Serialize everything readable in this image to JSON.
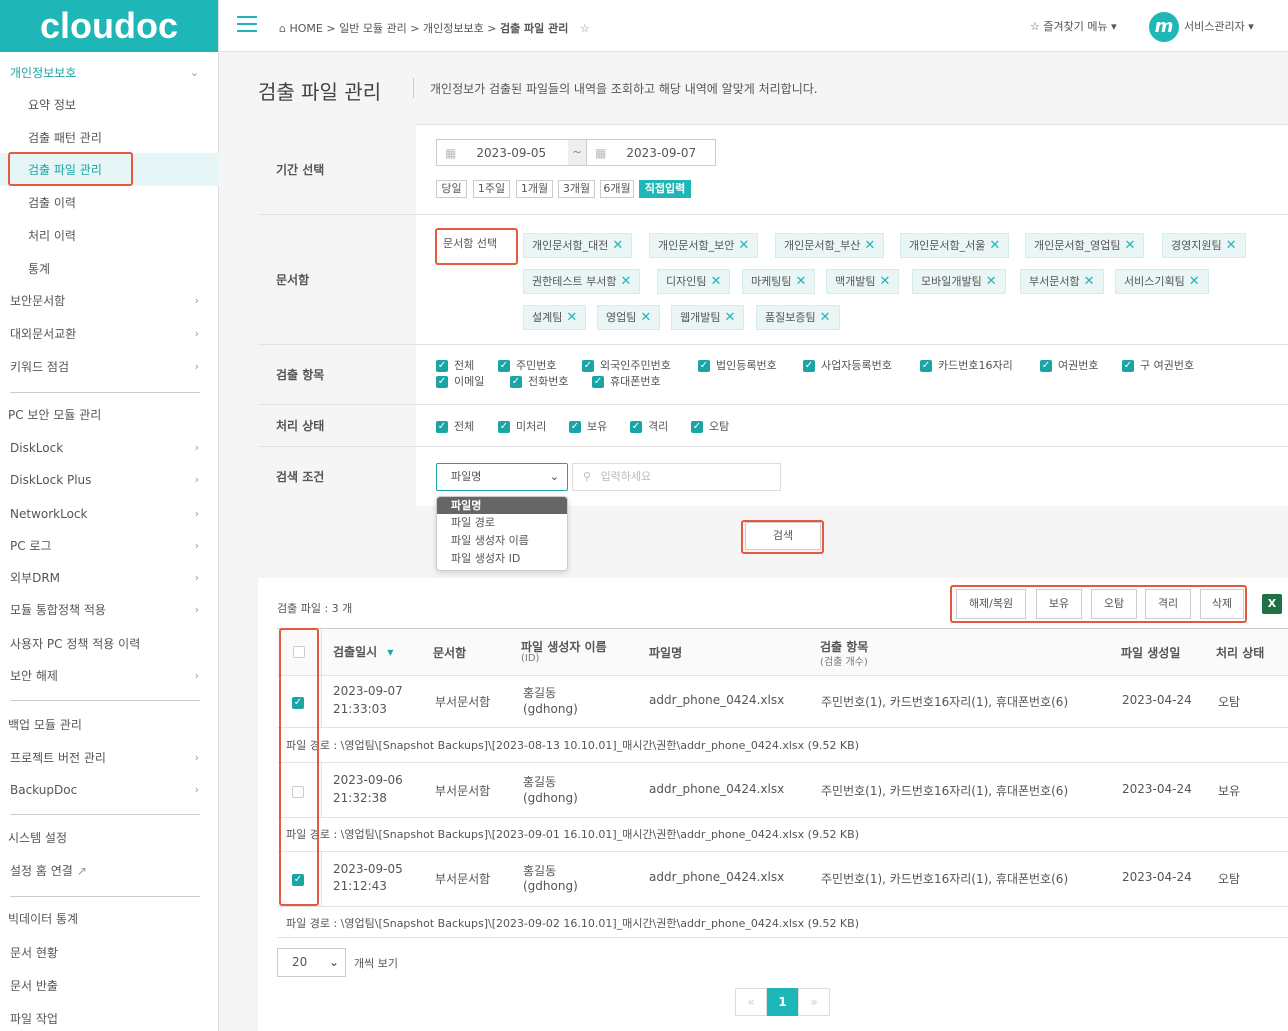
{
  "logo": "cloudoc",
  "breadcrumb": {
    "home": "HOME",
    "sep": ">",
    "b1": "일반 모듈 관리",
    "b2": "개인정보보호",
    "b3": "검출 파일 관리"
  },
  "header": {
    "favorites": "즐겨찾기 메뉴",
    "user": "서비스관리자"
  },
  "sidebar": {
    "groups": [
      {
        "label": "개인정보보호",
        "expanded": true
      },
      {
        "label": "보안문서함"
      },
      {
        "label": "대외문서교환"
      },
      {
        "label": "키워드 점검"
      }
    ],
    "privacy_items": [
      "요약 정보",
      "검출 패턴 관리",
      "검출 파일 관리",
      "검출 이력",
      "처리 이력",
      "통계"
    ],
    "section_pc": "PC 보안 모듈 관리",
    "pc_items": [
      "DiskLock",
      "DiskLock Plus",
      "NetworkLock",
      "PC 로그",
      "외부DRM",
      "모듈 통합정책 적용",
      "사용자 PC 정책 적용 이력",
      "보안 해제"
    ],
    "section_backup": "백업 모듈 관리",
    "backup_items": [
      "프로젝트 버전 관리",
      "BackupDoc"
    ],
    "section_system": "시스템 설정",
    "system_items": [
      "설정 홈 연결"
    ],
    "section_bigdata": "빅데이터 통계",
    "bigdata_items": [
      "문서 현황",
      "문서 반출",
      "파일 작업"
    ]
  },
  "page": {
    "title": "검출 파일 관리",
    "desc": "개인정보가 검출된 파일들의 내역을 조회하고 해당 내역에 알맞게 처리합니다."
  },
  "filters": {
    "period_label": "기간 선택",
    "date_from": "2023-09-05",
    "date_to": "2023-09-07",
    "date_sep": "~",
    "periods": [
      "당일",
      "1주일",
      "1개월",
      "3개월",
      "6개월",
      "직접입력"
    ],
    "box_label": "문서함",
    "box_select_btn": "문서함 선택",
    "boxes": [
      "개인문서함_대전",
      "개인문서함_보안",
      "개인문서함_부산",
      "개인문서함_서울",
      "개인문서함_영업팀",
      "경영지원팀",
      "권한테스트 부서함",
      "디자인팀",
      "마케팅팀",
      "맥개발팀",
      "모바일개발팀",
      "부서문서함",
      "서비스기획팀",
      "설계팀",
      "영업팀",
      "웹개발팀",
      "품질보증팀"
    ],
    "items_label": "검출 항목",
    "items": [
      "전체",
      "주민번호",
      "외국인주민번호",
      "법인등록번호",
      "사업자등록번호",
      "카드번호16자리",
      "여권번호",
      "구 여권번호",
      "이메일",
      "전화번호",
      "휴대폰번호"
    ],
    "status_label": "처리 상태",
    "statuses": [
      "전체",
      "미처리",
      "보유",
      "격리",
      "오탐"
    ],
    "search_label": "검색 조건",
    "search_select": "파일명",
    "search_placeholder": "입력하세요",
    "search_options": [
      "파일명",
      "파일 경로",
      "파일 생성자 이름",
      "파일 생성자 ID"
    ],
    "search_btn": "검색"
  },
  "results": {
    "count": "검출 파일 : 3 개",
    "actions": [
      "해제/복원",
      "보유",
      "오탐",
      "격리",
      "삭제"
    ],
    "columns": {
      "date": "검출일시",
      "box": "문서함",
      "creator": "파일 생성자 이름",
      "creator_sub": "(ID)",
      "filename": "파일명",
      "items": "검출 항목",
      "items_sub": "(검출 개수)",
      "created": "파일 생성일",
      "status": "처리 상태"
    },
    "rows": [
      {
        "checked": true,
        "date": "2023-09-07",
        "time": "21:33:03",
        "box": "부서문서함",
        "creator": "홍길동",
        "creator_id": "(gdhong)",
        "filename": "addr_phone_0424.xlsx",
        "items": "주민번호(1), 카드번호16자리(1), 휴대폰번호(6)",
        "created": "2023-04-24",
        "status": "오탐",
        "path": "파일 경로 : \\영업팀\\[Snapshot Backups]\\[2023-08-13 10.10.01]_매시간\\권한\\addr_phone_0424.xlsx (9.52 KB)"
      },
      {
        "checked": false,
        "date": "2023-09-06",
        "time": "21:32:38",
        "box": "부서문서함",
        "creator": "홍길동",
        "creator_id": "(gdhong)",
        "filename": "addr_phone_0424.xlsx",
        "items": "주민번호(1), 카드번호16자리(1), 휴대폰번호(6)",
        "created": "2023-04-24",
        "status": "보유",
        "path": "파일 경로 : \\영업팀\\[Snapshot Backups]\\[2023-09-01 16.10.01]_매시간\\권한\\addr_phone_0424.xlsx (9.52 KB)"
      },
      {
        "checked": true,
        "date": "2023-09-05",
        "time": "21:12:43",
        "box": "부서문서함",
        "creator": "홍길동",
        "creator_id": "(gdhong)",
        "filename": "addr_phone_0424.xlsx",
        "items": "주민번호(1), 카드번호16자리(1), 휴대폰번호(6)",
        "created": "2023-04-24",
        "status": "오탐",
        "path": "파일 경로 : \\영업팀\\[Snapshot Backups]\\[2023-09-02 16.10.01]_매시간\\권한\\addr_phone_0424.xlsx (9.52 KB)"
      }
    ],
    "page_size": "20",
    "page_size_label": "개씩 보기",
    "pager": {
      "prev": "«",
      "current": "1",
      "next": "»"
    }
  },
  "colors": {
    "accent": "#1fb6b8",
    "highlight": "#e55a3c"
  }
}
